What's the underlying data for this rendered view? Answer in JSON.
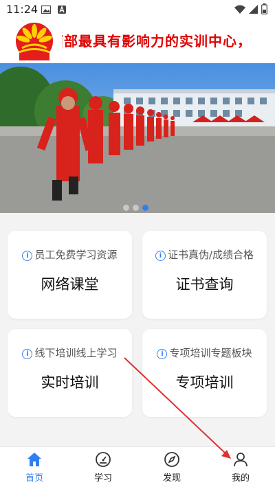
{
  "status_bar": {
    "time": "11:24"
  },
  "header": {
    "marquee_text": "西部最具有影响力的实训中心，"
  },
  "banner": {
    "slide_count": 3,
    "active_slide": 3
  },
  "cards": [
    {
      "subtitle": "员工免费学习资源",
      "title": "网络课堂"
    },
    {
      "subtitle": "证书真伪/成绩合格",
      "title": "证书查询"
    },
    {
      "subtitle": "线下培训线上学习",
      "title": "实时培训"
    },
    {
      "subtitle": "专项培训专题板块",
      "title": "专项培训"
    }
  ],
  "tabbar": {
    "items": [
      {
        "label": "首页",
        "icon": "home-icon",
        "active": true
      },
      {
        "label": "学习",
        "icon": "speedometer-icon",
        "active": false
      },
      {
        "label": "发现",
        "icon": "compass-icon",
        "active": false
      },
      {
        "label": "我的",
        "icon": "person-icon",
        "active": false
      }
    ]
  },
  "colors": {
    "accent": "#2f7ff0",
    "marquee": "#e00000",
    "annotation_arrow": "#e03030"
  }
}
